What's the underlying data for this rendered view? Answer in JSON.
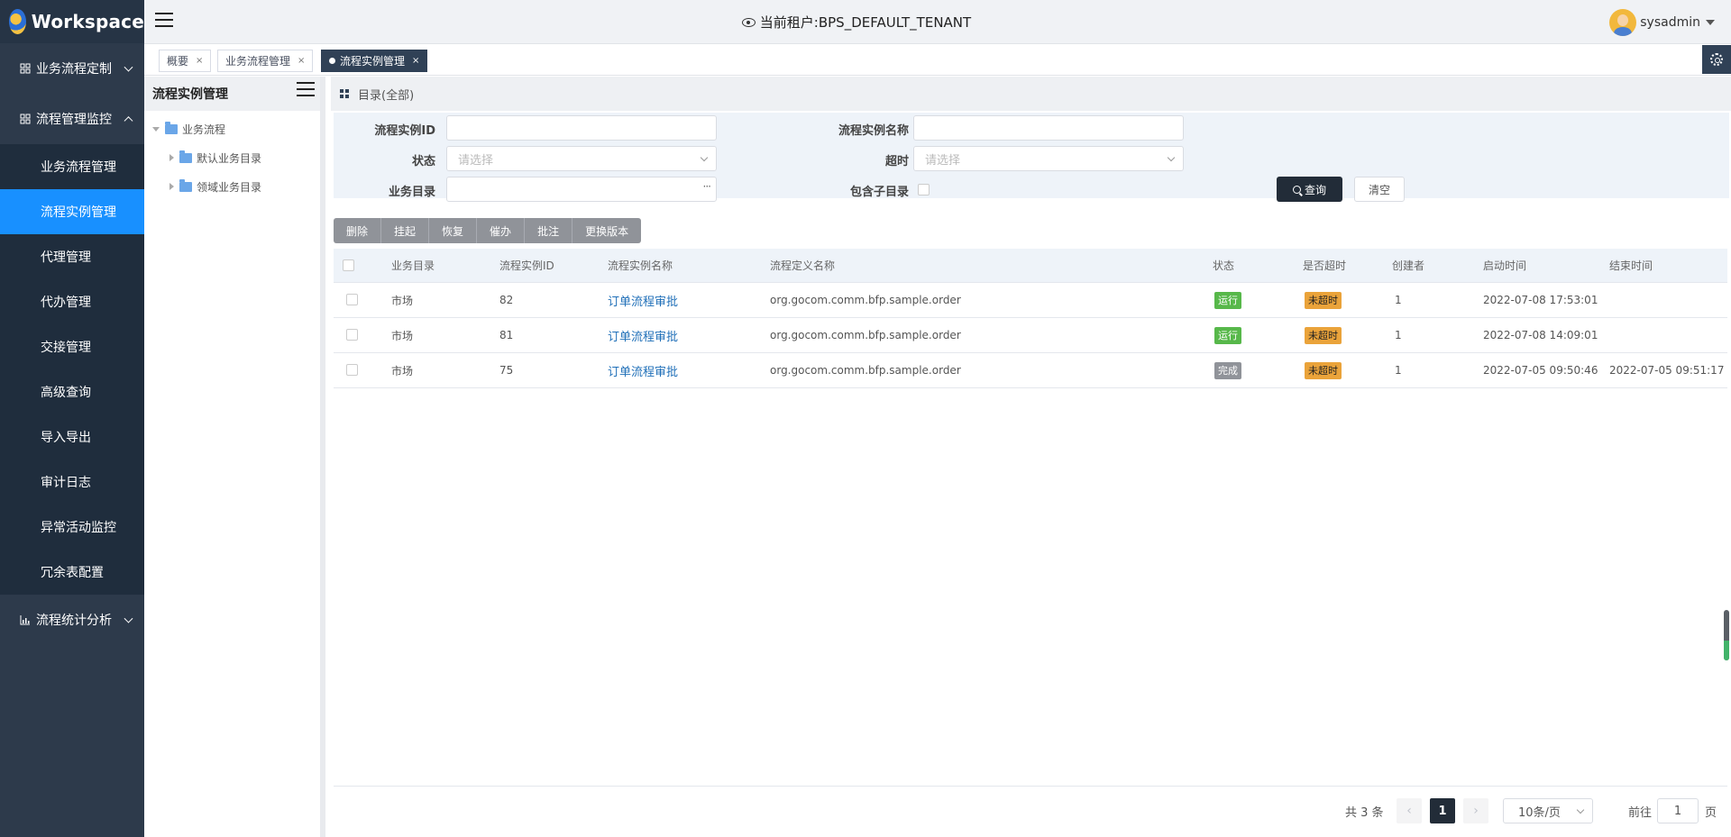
{
  "app": {
    "title": "Workspace"
  },
  "header": {
    "tenant_label": "当前租户:BPS_DEFAULT_TENANT",
    "username": "sysadmin"
  },
  "sidebar": {
    "groups": [
      {
        "label": "业务流程定制",
        "expanded": false
      },
      {
        "label": "流程管理监控",
        "expanded": true
      },
      {
        "label": "流程统计分析",
        "expanded": false
      }
    ],
    "items": [
      {
        "label": "业务流程管理",
        "active": false
      },
      {
        "label": "流程实例管理",
        "active": true
      },
      {
        "label": "代理管理",
        "active": false
      },
      {
        "label": "代办管理",
        "active": false
      },
      {
        "label": "交接管理",
        "active": false
      },
      {
        "label": "高级查询",
        "active": false
      },
      {
        "label": "导入导出",
        "active": false
      },
      {
        "label": "审计日志",
        "active": false
      },
      {
        "label": "异常活动监控",
        "active": false
      },
      {
        "label": "冗余表配置",
        "active": false
      }
    ]
  },
  "tabs": [
    {
      "label": "概要",
      "close": "×"
    },
    {
      "label": "业务流程管理",
      "close": "×"
    },
    {
      "label": "流程实例管理",
      "close": "×",
      "active": true
    }
  ],
  "tree": {
    "title": "流程实例管理",
    "nodes": [
      {
        "label": "业务流程",
        "expanded": true
      },
      {
        "label": "默认业务目录",
        "expanded": false
      },
      {
        "label": "领域业务目录",
        "expanded": false
      }
    ]
  },
  "directory": {
    "label": "目录(全部)"
  },
  "filters": {
    "instance_id_label": "流程实例ID",
    "instance_id_value": "",
    "instance_name_label": "流程实例名称",
    "instance_name_value": "",
    "status_label": "状态",
    "status_placeholder": "请选择",
    "timeout_label": "超时",
    "timeout_placeholder": "请选择",
    "catalog_label": "业务目录",
    "catalog_value": "",
    "catalog_dots": "···",
    "include_sub_label": "包含子目录",
    "include_sub_checked": false,
    "query_label": "查询",
    "clear_label": "清空"
  },
  "toolbar": [
    "删除",
    "挂起",
    "恢复",
    "催办",
    "批注",
    "更换版本"
  ],
  "table": {
    "columns": [
      "业务目录",
      "流程实例ID",
      "流程实例名称",
      "流程定义名称",
      "状态",
      "是否超时",
      "创建者",
      "启动时间",
      "结束时间"
    ],
    "rows": [
      {
        "catalog": "市场",
        "id": "82",
        "name": "订单流程审批",
        "definition": "org.gocom.comm.bfp.sample.order",
        "status": "运行",
        "timeout": "未超时",
        "creator": "1",
        "start": "2022-07-08 17:53:01",
        "end": ""
      },
      {
        "catalog": "市场",
        "id": "81",
        "name": "订单流程审批",
        "definition": "org.gocom.comm.bfp.sample.order",
        "status": "运行",
        "timeout": "未超时",
        "creator": "1",
        "start": "2022-07-08 14:09:01",
        "end": ""
      },
      {
        "catalog": "市场",
        "id": "75",
        "name": "订单流程审批",
        "definition": "org.gocom.comm.bfp.sample.order",
        "status": "完成",
        "timeout": "未超时",
        "creator": "1",
        "start": "2022-07-05 09:50:46",
        "end": "2022-07-05 09:51:17"
      }
    ]
  },
  "pagination": {
    "total": "共 3 条",
    "prev": "‹",
    "next": "›",
    "current": "1",
    "page_size": "10条/页",
    "goto_prefix": "前往",
    "goto_value": "1",
    "goto_suffix": "页"
  },
  "colors": {
    "sidebar_bg": "#2d3a4b",
    "active_menu": "#1890ff",
    "dark": "#304156",
    "link": "#1f6fb8",
    "status_run": "#57b84a",
    "status_done": "#909399",
    "timeout_badge": "#eaa33a"
  }
}
